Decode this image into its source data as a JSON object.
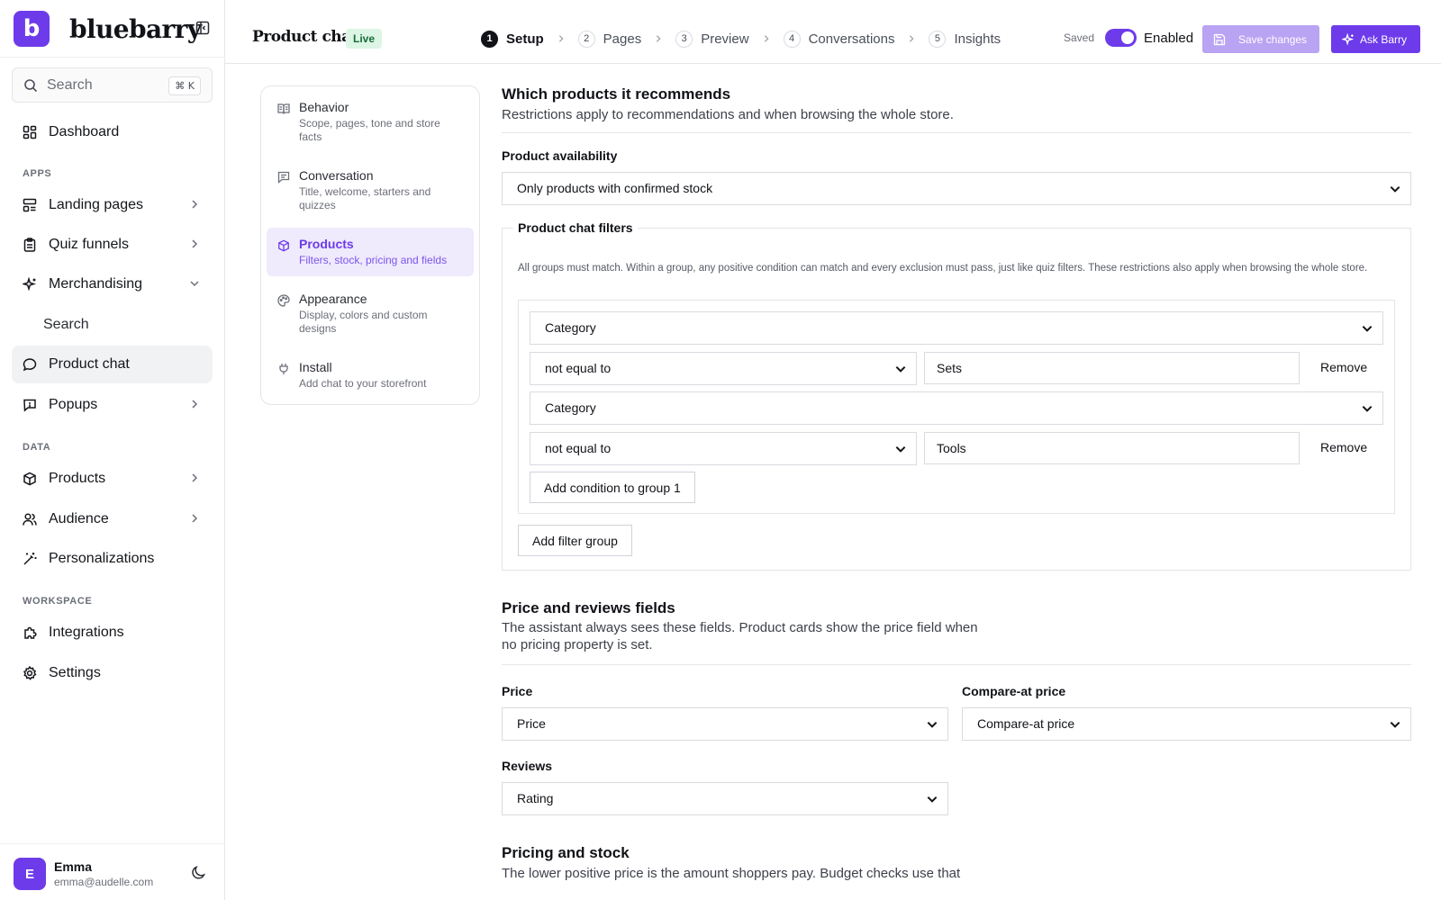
{
  "brand": {
    "logo_letter": "b",
    "name": "bluebarry",
    "accent": "#6d3bea"
  },
  "sidebar": {
    "search": {
      "label": "Search",
      "shortcut": "⌘ K"
    },
    "dashboard": "Dashboard",
    "apps_label": "APPS",
    "apps": [
      {
        "label": "Landing pages"
      },
      {
        "label": "Quiz funnels"
      },
      {
        "label": "Merchandising"
      }
    ],
    "merch_sub": "Search",
    "product_chat": "Product chat",
    "popups": "Popups",
    "data_label": "DATA",
    "data": [
      {
        "label": "Products"
      },
      {
        "label": "Audience"
      },
      {
        "label": "Personalizations"
      }
    ],
    "workspace_label": "WORKSPACE",
    "workspace": [
      {
        "label": "Integrations"
      },
      {
        "label": "Settings"
      }
    ],
    "user": {
      "initial": "E",
      "name": "Emma",
      "email": "emma@audelle.com"
    }
  },
  "topbar": {
    "title": "Product chat",
    "badge": "Live",
    "steps": [
      {
        "num": "1",
        "label": "Setup"
      },
      {
        "num": "2",
        "label": "Pages"
      },
      {
        "num": "3",
        "label": "Preview"
      },
      {
        "num": "4",
        "label": "Conversations"
      },
      {
        "num": "5",
        "label": "Insights"
      }
    ],
    "saved": "Saved",
    "enabled": "Enabled",
    "save_changes": "Save changes",
    "ask_barry": "Ask Barry"
  },
  "subnav": [
    {
      "title": "Behavior",
      "desc": "Scope, pages, tone and store facts"
    },
    {
      "title": "Conversation",
      "desc": "Title, welcome, starters and quizzes"
    },
    {
      "title": "Products",
      "desc": "Filters, stock, pricing and fields"
    },
    {
      "title": "Appearance",
      "desc": "Display, colors and custom designs"
    },
    {
      "title": "Install",
      "desc": "Add chat to your storefront"
    }
  ],
  "recommends": {
    "title": "Which products it recommends",
    "subtitle": "Restrictions apply to recommendations and when browsing the whole store.",
    "availability_label": "Product availability",
    "availability_value": "Only products with confirmed stock"
  },
  "filters": {
    "legend": "Product chat filters",
    "description": "All groups must match. Within a group, any positive condition can match and every exclusion must pass, just like quiz filters. These restrictions also apply when browsing the whole store.",
    "conditions": [
      {
        "field": "Category",
        "operator": "not equal to",
        "value": "Sets",
        "remove": "Remove"
      },
      {
        "field": "Category",
        "operator": "not equal to",
        "value": "Tools",
        "remove": "Remove"
      }
    ],
    "add_condition": "Add condition to group 1",
    "add_group": "Add filter group"
  },
  "price_fields": {
    "title": "Price and reviews fields",
    "subtitle_line1": "The assistant always sees these fields. Product cards show the price field when",
    "subtitle_line2": "no pricing property is set.",
    "price_label": "Price",
    "price_value": "Price",
    "compare_label": "Compare-at price",
    "compare_value": "Compare-at price",
    "reviews_label": "Reviews",
    "reviews_value": "Rating"
  },
  "pricing_stock": {
    "title": "Pricing and stock",
    "subtitle": "The lower positive price is the amount shoppers pay. Budget checks use that"
  }
}
